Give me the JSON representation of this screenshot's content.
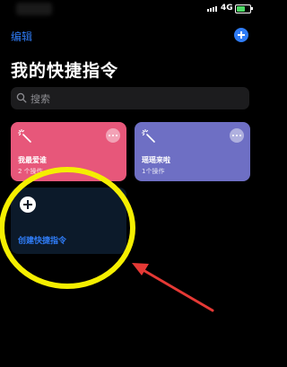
{
  "status_bar": {
    "network": "4G"
  },
  "header": {
    "edit_label": "编辑",
    "title": "我的快捷指令"
  },
  "search": {
    "placeholder": "搜索"
  },
  "shortcuts": [
    {
      "title": "我最爱谁",
      "subtitle": "2 个操作",
      "color": "#e7577a"
    },
    {
      "title": "瑶瑶来啦",
      "subtitle": "1个操作",
      "color": "#6e6fc4"
    }
  ],
  "create_card": {
    "label": "创建快捷指令"
  },
  "colors": {
    "accent": "#2f7cf6",
    "highlight_ring": "#f5ef00",
    "arrow": "#e53935"
  },
  "icons": [
    "add-icon",
    "search-icon",
    "magic-wand-icon",
    "more-icon",
    "battery-icon",
    "signal-icon"
  ]
}
